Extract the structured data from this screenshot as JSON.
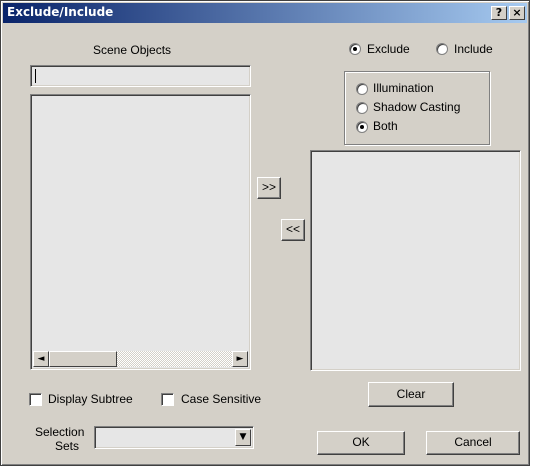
{
  "window": {
    "title": "Exclude/Include",
    "help_label": "?",
    "close_label": "×"
  },
  "left": {
    "heading": "Scene Objects",
    "filter_value": "",
    "scroll_left_glyph": "◄",
    "scroll_right_glyph": "►"
  },
  "transfer": {
    "add_label": ">>",
    "remove_label": "<<"
  },
  "mode": {
    "exclude_label": "Exclude",
    "include_label": "Include",
    "selected": "Exclude"
  },
  "type": {
    "illumination_label": "Illumination",
    "shadow_label": "Shadow Casting",
    "both_label": "Both",
    "selected": "Both"
  },
  "options": {
    "display_subtree_label": "Display Subtree",
    "case_sensitive_label": "Case Sensitive"
  },
  "selection_sets": {
    "label_line1": "Selection",
    "label_line2": "Sets",
    "value": "",
    "dropdown_glyph": "▼"
  },
  "buttons": {
    "clear": "Clear",
    "ok": "OK",
    "cancel": "Cancel"
  }
}
